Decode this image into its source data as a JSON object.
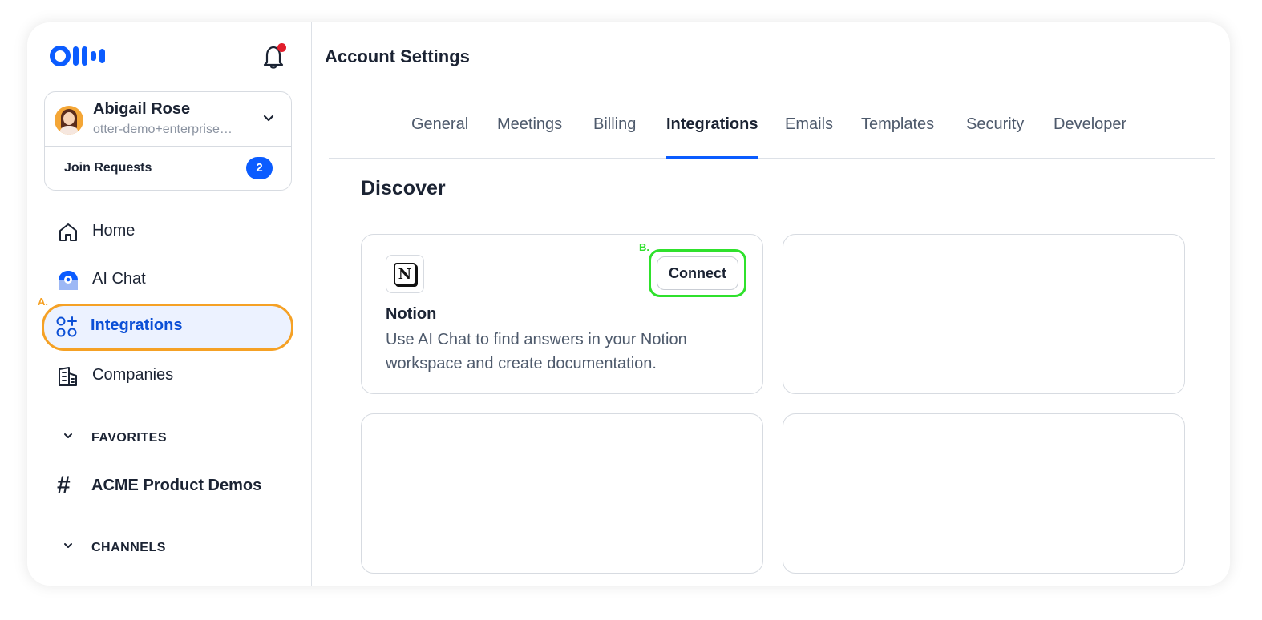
{
  "sidebar": {
    "user": {
      "name": "Abigail Rose",
      "email": "otter-demo+enterprise@otter.ai"
    },
    "join_requests": {
      "label": "Join Requests",
      "count": "2"
    },
    "nav": [
      {
        "label": "Home",
        "icon": "home-icon"
      },
      {
        "label": "AI Chat",
        "icon": "ai-chat-icon"
      },
      {
        "label": "Integrations",
        "icon": "integrations-icon",
        "active": true
      },
      {
        "label": "Companies",
        "icon": "companies-icon"
      }
    ],
    "favorites": {
      "label": "FAVORITES"
    },
    "favorite_channel": {
      "label": "ACME Product Demos",
      "icon": "#"
    },
    "channels": {
      "label": "CHANNELS"
    }
  },
  "annotations": {
    "a": "A.",
    "b": "B."
  },
  "main": {
    "title": "Account Settings",
    "tabs": [
      {
        "label": "General"
      },
      {
        "label": "Meetings"
      },
      {
        "label": "Billing"
      },
      {
        "label": "Integrations",
        "active": true
      },
      {
        "label": "Emails"
      },
      {
        "label": "Templates"
      },
      {
        "label": "Security"
      },
      {
        "label": "Developer"
      }
    ],
    "section_title": "Discover",
    "cards": [
      {
        "title": "Notion",
        "logo_letter": "N",
        "description": "Use AI Chat to find answers in your Notion workspace and create documentation.",
        "button_label": "Connect"
      }
    ]
  },
  "colors": {
    "accent_blue": "#0b5cff",
    "highlight_orange": "#f5a125",
    "highlight_green": "#2fe12c",
    "notification_red": "#e11d2b"
  }
}
